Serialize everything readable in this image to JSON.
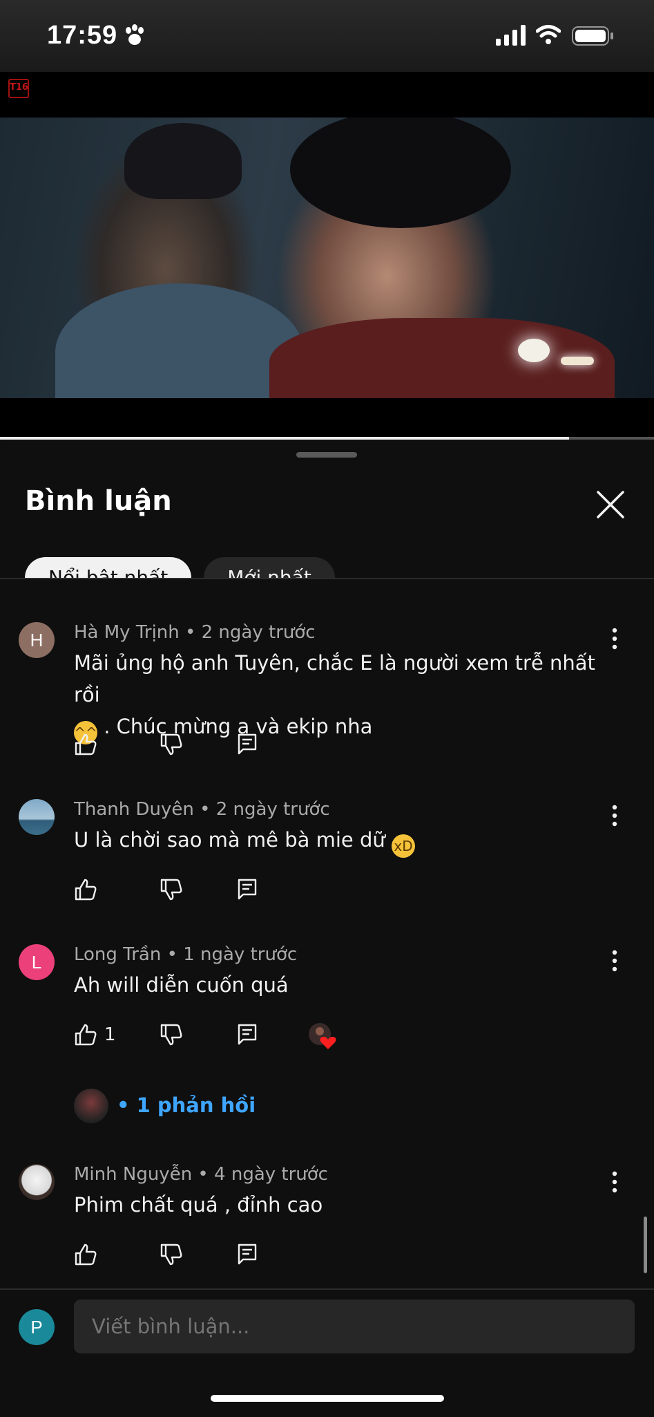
{
  "status": {
    "time": "17:59",
    "icons": [
      "paw-icon",
      "cellular-signal-icon",
      "wifi-icon",
      "battery-icon"
    ]
  },
  "video": {
    "rating": "T16",
    "progress_fraction": 0.87
  },
  "sheet": {
    "title": "Bình luận",
    "chips": [
      {
        "label": "Nổi bật nhất",
        "active": true
      },
      {
        "label": "Mới nhất",
        "active": false
      }
    ],
    "comments": [
      {
        "initial": "H",
        "avatar_color": "#8d6e63",
        "meta": "Hà My Trịnh • 2 ngày trước",
        "text_line1": "Mãi ủng hộ anh Tuyên, chắc E là người xem trễ nhất rồi",
        "text_line2": ". Chúc mừng a và ekip nha",
        "emoji": "laughing-face-emoji",
        "likes": ""
      },
      {
        "initial": "",
        "avatar_color": "#6f9ab8",
        "meta": "Thanh Duyên • 2 ngày trước",
        "text": "U là chời sao mà mê bà mie dữ",
        "emoji": "rolling-laughing-emoji",
        "likes": ""
      },
      {
        "initial": "L",
        "avatar_color": "#ec407a",
        "meta": "Long Trần • 1 ngày trước",
        "text": "Ah will diễn cuốn quá",
        "likes": "1"
      },
      {
        "initial": "",
        "avatar_color": "#e0e0e0",
        "meta": "Minh Nguyễn • 4 ngày trước",
        "text": "Phim chất quá , đỉnh cao",
        "likes": ""
      }
    ],
    "replies_label": "• 1 phản hồi",
    "input_placeholder": "Viết bình luận...",
    "self_initial": "P",
    "accent": "#3ea6ff"
  }
}
